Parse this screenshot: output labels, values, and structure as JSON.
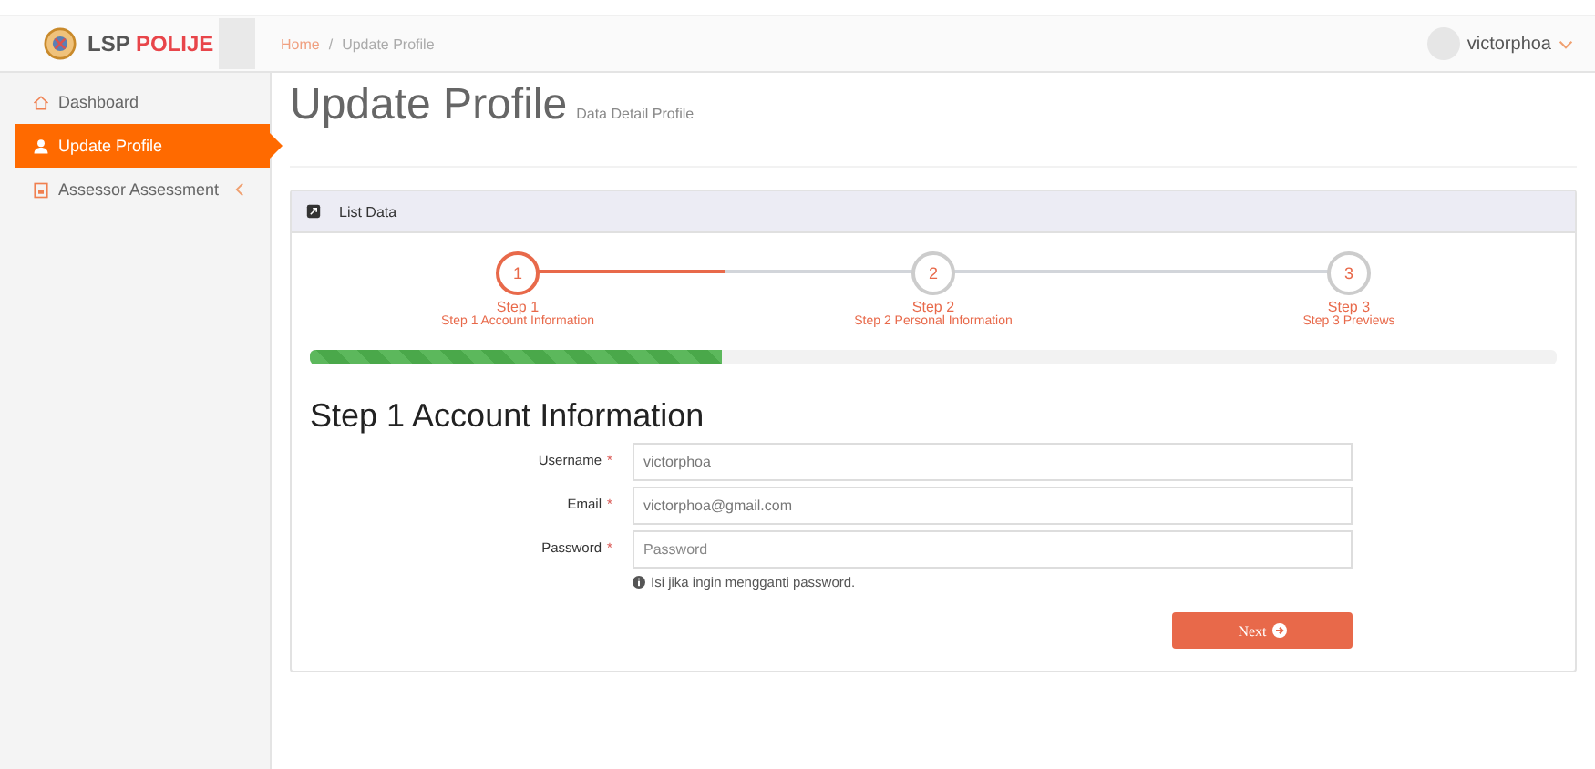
{
  "brand": {
    "name_part_1": "LSP",
    "name_part_2": "POLIJE"
  },
  "breadcrumb": {
    "items": [
      "Home",
      "Update Profile"
    ],
    "separator": "/"
  },
  "user": {
    "name": "victorphoa"
  },
  "sidebar": {
    "items": [
      {
        "label": "Dashboard",
        "kind": "home",
        "selected": false,
        "submenu": false
      },
      {
        "label": "Update Profile",
        "kind": "user",
        "selected": true,
        "submenu": false
      },
      {
        "label": "Assessor Assessment",
        "kind": "file",
        "selected": false,
        "submenu": true
      }
    ]
  },
  "page": {
    "title": "Update Profile",
    "subtitle": "Data Detail Profile"
  },
  "panel": {
    "title": "List Data"
  },
  "steps": [
    {
      "number": "1",
      "title": "Step 1",
      "caption": "Step 1 Account Information",
      "selected": true
    },
    {
      "number": "2",
      "title": "Step 2",
      "caption": "Step 2 Personal Information",
      "selected": false
    },
    {
      "number": "3",
      "title": "Step 3",
      "caption": "Step 3 Previews",
      "selected": false
    }
  ],
  "progress": {
    "level": 0.33
  },
  "form": {
    "heading": "Step 1 Account Information",
    "fields": [
      {
        "label": "Username",
        "required_mark": "*",
        "value": "victorphoa"
      },
      {
        "label": "Email",
        "required_mark": "*",
        "value": "victorphoa@gmail.com"
      },
      {
        "label": "Password",
        "required_mark": "*",
        "placeholder": "Password"
      }
    ],
    "hint": "Isi jika ingin mengganti password.",
    "button": "Next"
  }
}
